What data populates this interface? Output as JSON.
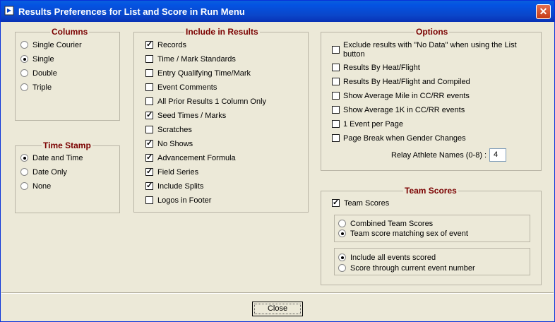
{
  "window": {
    "title": "Results Preferences for List and Score in Run Menu"
  },
  "columns": {
    "title": "Columns",
    "options": [
      {
        "label": "Single Courier",
        "selected": false
      },
      {
        "label": "Single",
        "selected": true
      },
      {
        "label": "Double",
        "selected": false
      },
      {
        "label": "Triple",
        "selected": false
      }
    ]
  },
  "time_stamp": {
    "title": "Time Stamp",
    "options": [
      {
        "label": "Date and Time",
        "selected": true
      },
      {
        "label": "Date Only",
        "selected": false
      },
      {
        "label": "None",
        "selected": false
      }
    ]
  },
  "include": {
    "title": "Include in Results",
    "items": [
      {
        "label": "Records",
        "checked": true
      },
      {
        "label": "Time / Mark Standards",
        "checked": false
      },
      {
        "label": "Entry Qualifying Time/Mark",
        "checked": false
      },
      {
        "label": "Event Comments",
        "checked": false
      },
      {
        "label": "All Prior Results 1 Column Only",
        "checked": false
      },
      {
        "label": "Seed Times / Marks",
        "checked": true
      },
      {
        "label": "Scratches",
        "checked": false
      },
      {
        "label": "No Shows",
        "checked": true
      },
      {
        "label": "Advancement Formula",
        "checked": true
      },
      {
        "label": "Field Series",
        "checked": true
      },
      {
        "label": "Include Splits",
        "checked": true
      },
      {
        "label": "Logos in Footer",
        "checked": false
      }
    ]
  },
  "options": {
    "title": "Options",
    "items": [
      {
        "label": "Exclude results with \"No Data\" when using the List",
        "label2": "button",
        "checked": false
      },
      {
        "label": "Results By Heat/Flight",
        "checked": false
      },
      {
        "label": "Results By Heat/Flight and Compiled",
        "checked": false
      },
      {
        "label": "Show Average Mile in CC/RR events",
        "checked": false
      },
      {
        "label": "Show Average 1K in CC/RR events",
        "checked": false
      },
      {
        "label": "1 Event per Page",
        "checked": false
      },
      {
        "label": "Page Break when Gender Changes",
        "checked": false
      }
    ],
    "relay_label": "Relay Athlete Names (0-8) :",
    "relay_value": "4"
  },
  "team_scores": {
    "title": "Team Scores",
    "enable_label": "Team Scores",
    "enable_checked": true,
    "group1": [
      {
        "label": "Combined Team Scores",
        "selected": false
      },
      {
        "label": "Team score matching sex of event",
        "selected": true
      }
    ],
    "group2": [
      {
        "label": "Include all events scored",
        "selected": true
      },
      {
        "label": "Score through current event number",
        "selected": false
      }
    ]
  },
  "close_label": "Close"
}
